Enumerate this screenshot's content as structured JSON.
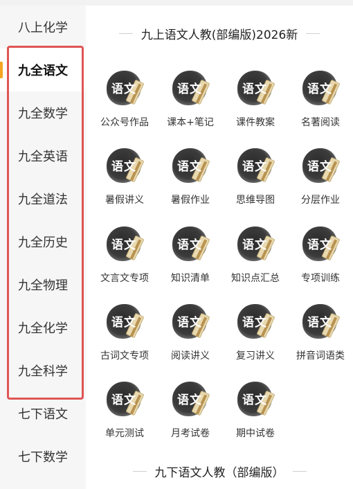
{
  "sidebar": {
    "items": [
      {
        "label": "八上化学"
      },
      {
        "label": "九全语文"
      },
      {
        "label": "九全数学"
      },
      {
        "label": "九全英语"
      },
      {
        "label": "九全道法"
      },
      {
        "label": "九全历史"
      },
      {
        "label": "九全物理"
      },
      {
        "label": "九全化学"
      },
      {
        "label": "九全科学"
      },
      {
        "label": "七下语文"
      },
      {
        "label": "七下数学"
      }
    ],
    "active_index": 1,
    "highlight_color": "#e05555",
    "active_bar_color": "#f5a623"
  },
  "main": {
    "section1_title": "九上语文人教(部编版)2026新",
    "section2_title": "九下语文人教（部编版）",
    "icon_text": "语文",
    "icon_name": "yuwen-ink-scroll-icon",
    "items": [
      {
        "label": "公众号作品"
      },
      {
        "label": "课本+笔记"
      },
      {
        "label": "课件教案"
      },
      {
        "label": "名著阅读"
      },
      {
        "label": "暑假讲义"
      },
      {
        "label": "暑假作业"
      },
      {
        "label": "思维导图"
      },
      {
        "label": "分层作业"
      },
      {
        "label": "文言文专项"
      },
      {
        "label": "知识清单"
      },
      {
        "label": "知识点汇总"
      },
      {
        "label": "专项训练"
      },
      {
        "label": "古词文专项"
      },
      {
        "label": "阅读讲义"
      },
      {
        "label": "复习讲义"
      },
      {
        "label": "拼音词语类"
      },
      {
        "label": "单元测试"
      },
      {
        "label": "月考试卷"
      },
      {
        "label": "期中试卷"
      }
    ]
  }
}
